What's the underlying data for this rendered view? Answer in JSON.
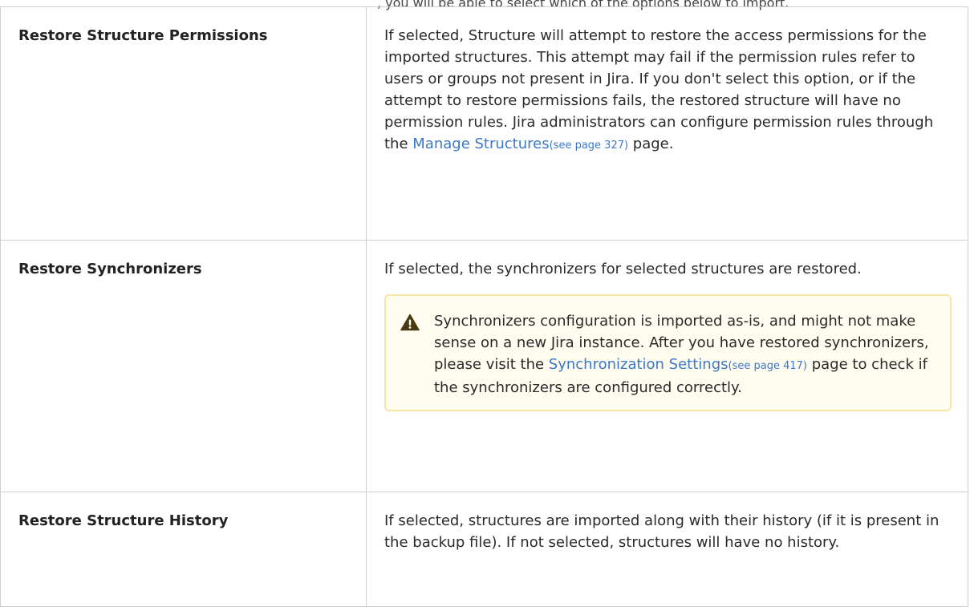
{
  "header_fragment": ", you will be able to select which of the options below to import.",
  "options": [
    {
      "name": "Restore Structure Permissions",
      "description_before_link": "If selected, Structure will attempt to restore the access permissions for the imported structures. This attempt may fail if the permission rules refer to users or groups not present in Jira. If you don't select this option, or if the attempt to restore permissions fails, the restored structure will have no permission rules. Jira administrators can configure permission rules through the ",
      "link_text": "Manage Structures",
      "link_page": "(see page 327)",
      "description_after_link": " page."
    },
    {
      "name": "Restore Synchronizers",
      "description": "If selected, the synchronizers for selected structures are restored.",
      "note": {
        "icon": "warning-icon",
        "text_before_link": "Synchronizers configuration is imported as-is, and might not make sense on a new Jira instance. After you have restored synchronizers, please visit the ",
        "link_text": "Synchronization Settings",
        "link_page": "(see page 417)",
        "text_after_link": " page to check if the synchronizers are configured correctly."
      }
    },
    {
      "name": "Restore Structure History",
      "description": "If selected, structures are imported along with their history (if it is present in the backup file). If not selected, structures will have no history."
    }
  ],
  "colors": {
    "link": "#3c78c8",
    "border": "#cfcfcf",
    "note_background": "#fffcf0",
    "note_border": "#f5e6a8",
    "warning_icon": "#4a3a10"
  }
}
